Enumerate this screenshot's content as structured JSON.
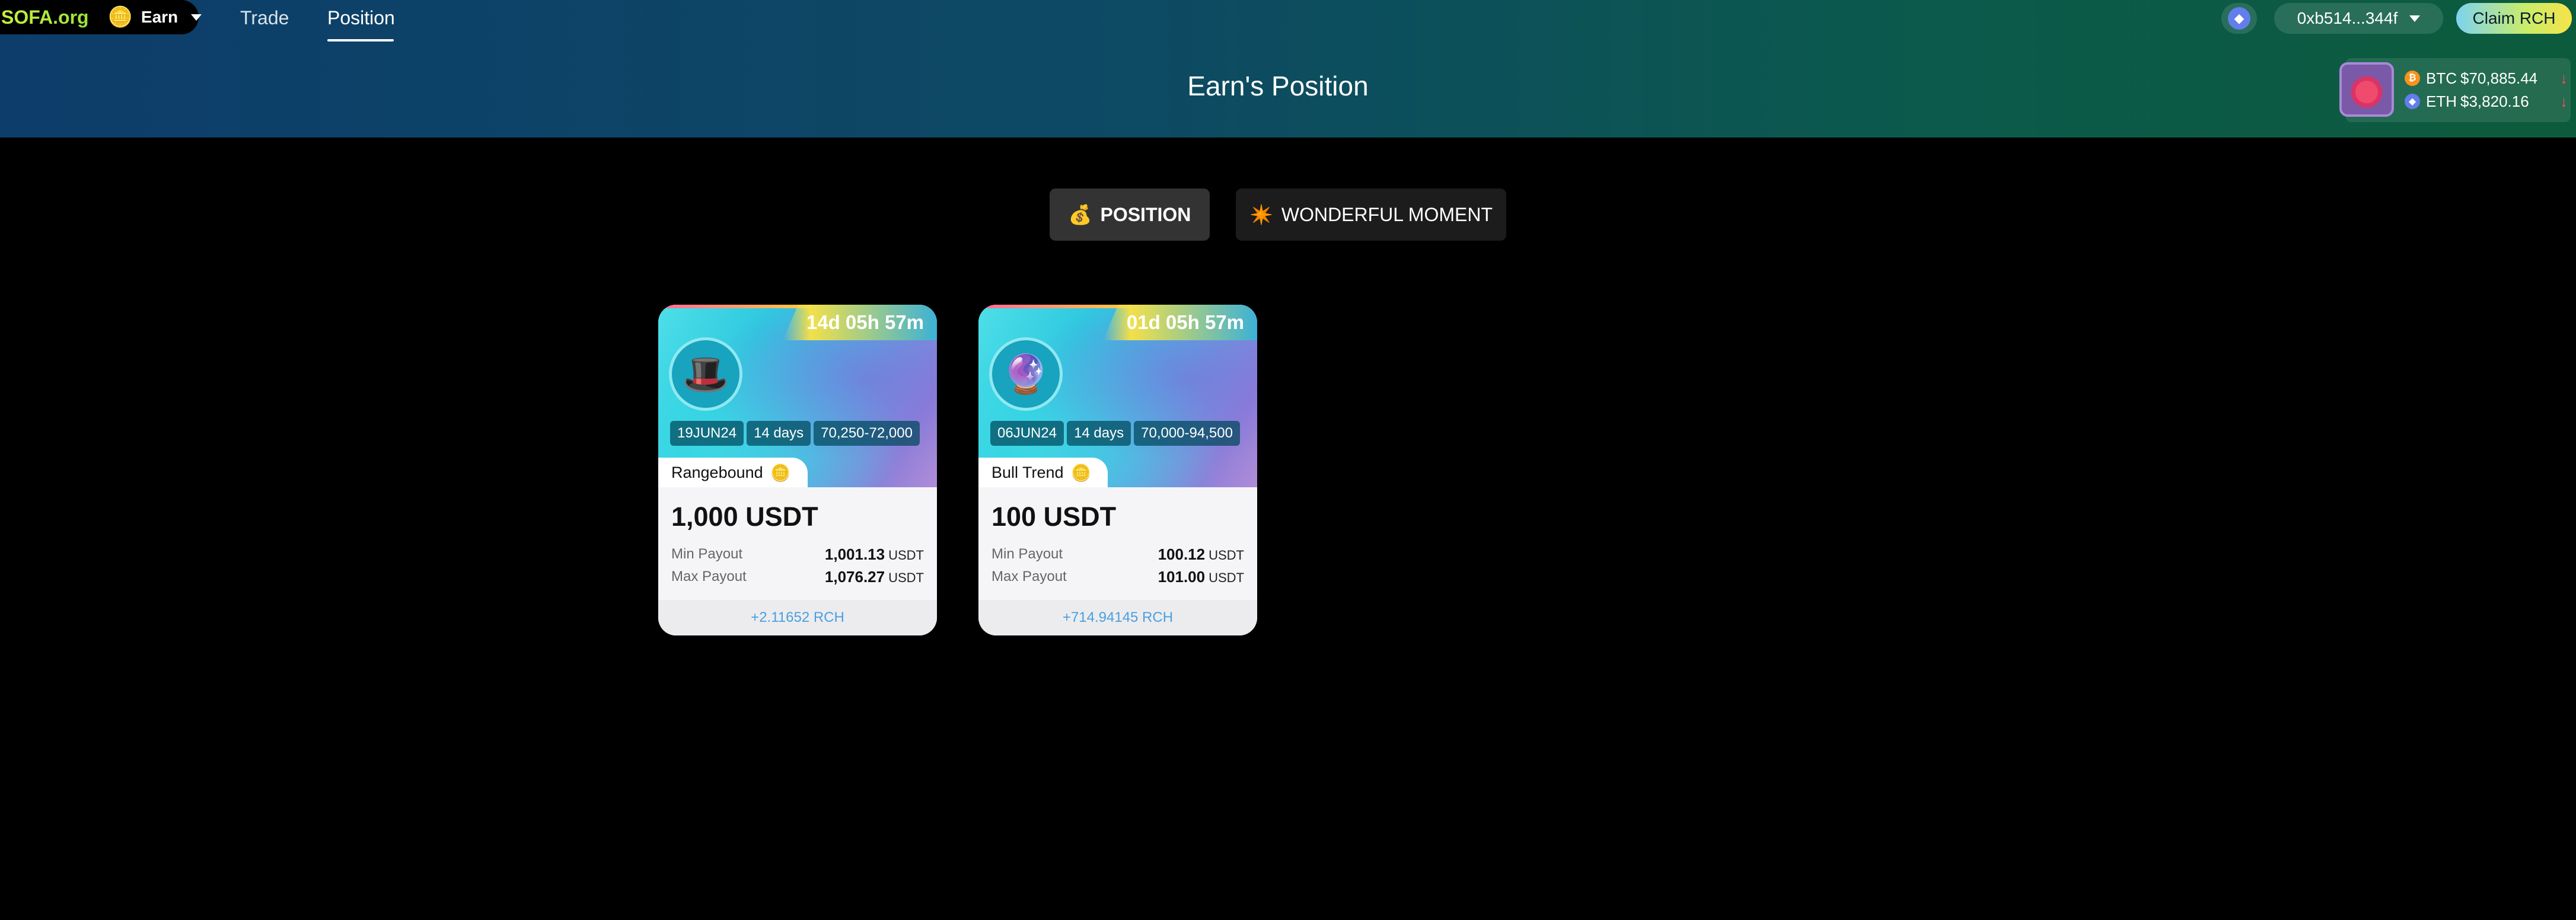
{
  "header": {
    "logo": "SOFA.org",
    "product_icon": "earn-coin-icon",
    "product_label": "Earn",
    "nav": [
      {
        "label": "Trade",
        "active": false
      },
      {
        "label": "Position",
        "active": true
      }
    ],
    "page_title": "Earn's Position",
    "chain_icon": "ethereum-icon",
    "wallet_address": "0xb514...344f",
    "claim_label": "Claim RCH",
    "prices": [
      {
        "symbol": "BTC",
        "value": "$70,885.44",
        "trend": "down"
      },
      {
        "symbol": "ETH",
        "value": "$3,820.16",
        "trend": "down"
      }
    ]
  },
  "tabs": [
    {
      "icon": "💰",
      "label": "POSITION",
      "active": true
    },
    {
      "icon": "✴️",
      "label": "WONDERFUL MOMENT",
      "active": false
    }
  ],
  "cards": [
    {
      "timer": "14d 05h 57m",
      "avatar_icon": "top-hat-icon",
      "tags": [
        "19JUN24",
        "14 days",
        "70,250-72,000"
      ],
      "product": "Rangebound",
      "amount": "1,000 USDT",
      "min_payout_label": "Min Payout",
      "min_payout": "1,001.13",
      "max_payout_label": "Max Payout",
      "max_payout": "1,076.27",
      "unit": "USDT",
      "reward": "+2.11652 RCH"
    },
    {
      "timer": "01d 05h 57m",
      "avatar_icon": "crystal-ball-icon",
      "tags": [
        "06JUN24",
        "14 days",
        "70,000-94,500"
      ],
      "product": "Bull Trend",
      "amount": "100 USDT",
      "min_payout_label": "Min Payout",
      "min_payout": "100.12",
      "max_payout_label": "Max Payout",
      "max_payout": "101.00",
      "unit": "USDT",
      "reward": "+714.94145 RCH"
    }
  ],
  "colors": {
    "accent_green": "#c6f23b",
    "trend_down": "#ff4b5c",
    "reward_blue": "#4a9fe0"
  }
}
